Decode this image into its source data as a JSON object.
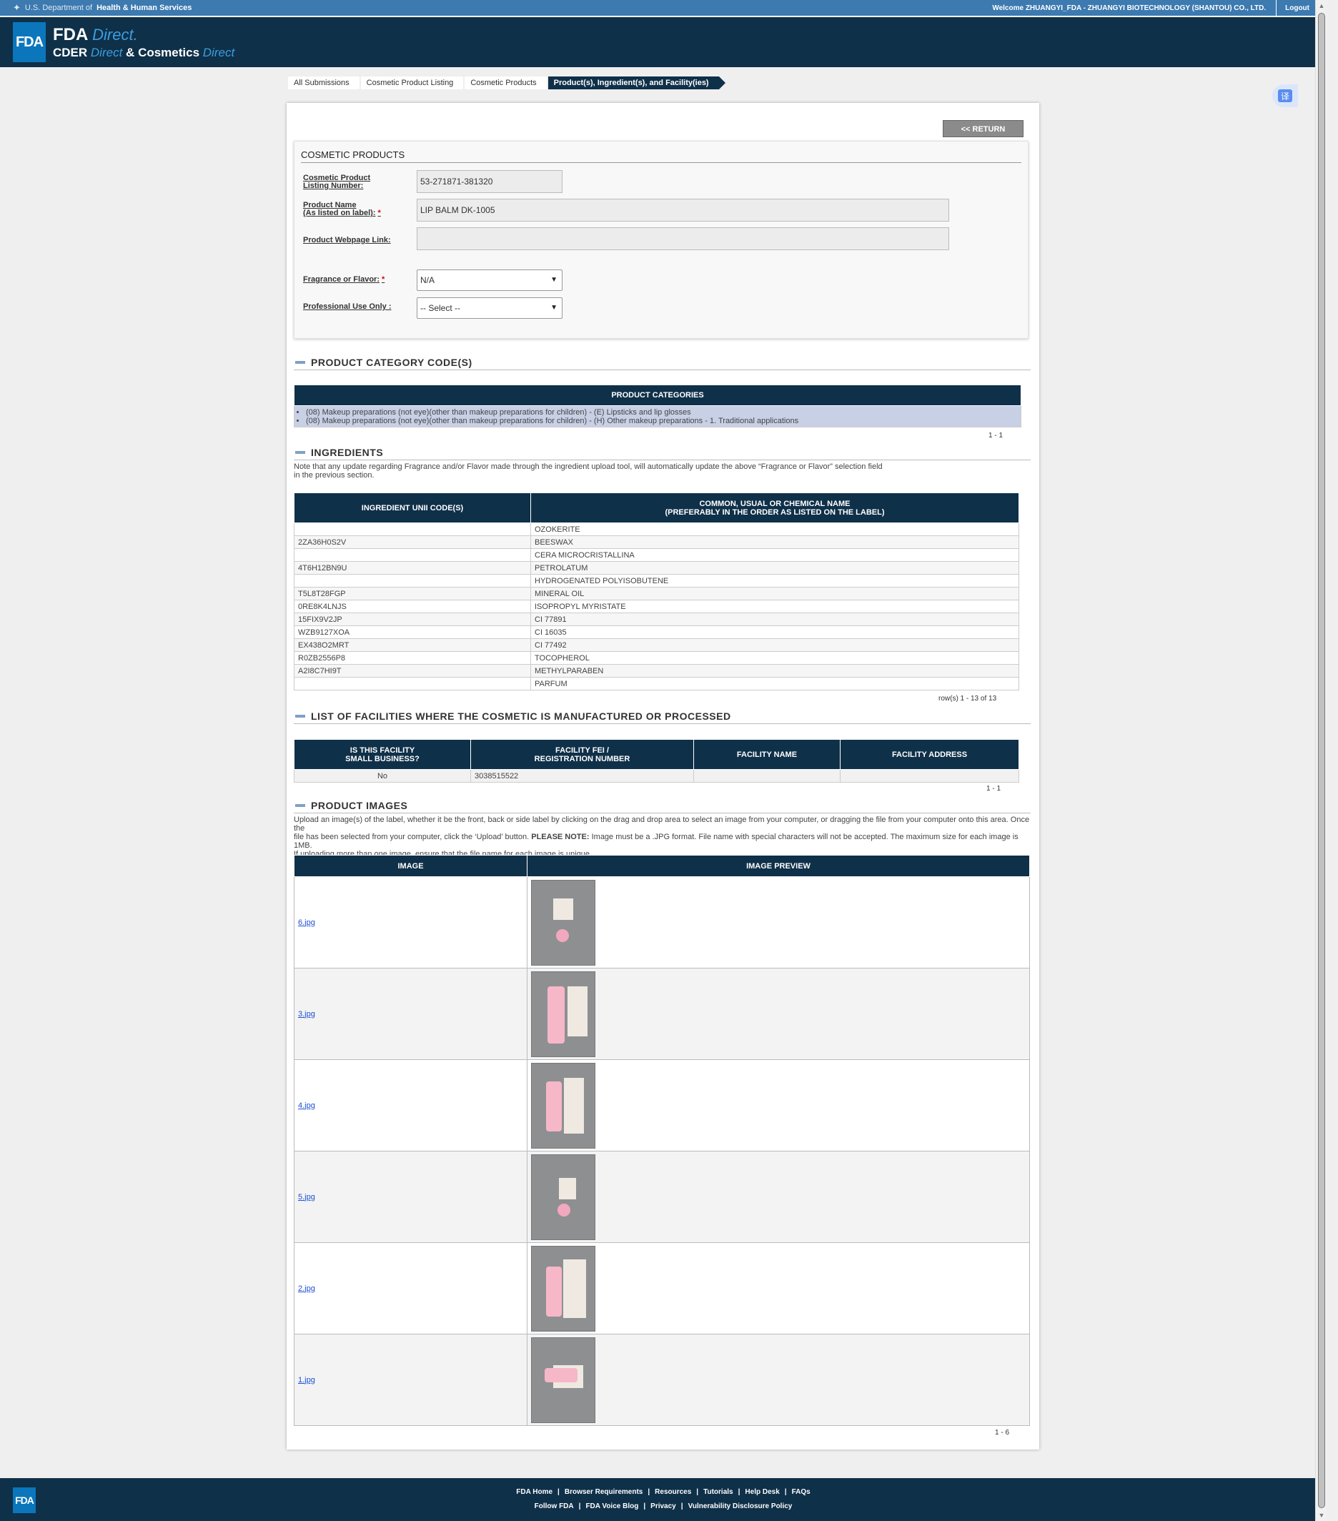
{
  "topbar": {
    "dept_prefix": "U.S. Department of",
    "dept_name": "Health & Human Services",
    "welcome": "Welcome ZHUANGYI_FDA - ZHUANGYI BIOTECHNOLOGY (SHANTOU) CO., LTD.",
    "logout": "Logout"
  },
  "header": {
    "logo": "FDA",
    "fda": "FDA",
    "direct": "Direct",
    "cder": "CDER",
    "direct2": "Direct",
    "amp": "&",
    "cosmetics": "Cosmetics",
    "direct3": "Direct"
  },
  "breadcrumb": [
    "All Submissions",
    "Cosmetic Product Listing",
    "Cosmetic Products",
    "Product(s), Ingredient(s), and Facility(ies)"
  ],
  "return_label": "<< RETURN",
  "cosmetic_products": {
    "title": "COSMETIC PRODUCTS",
    "listing_label_1": "Cosmetic Product",
    "listing_label_2": "Listing Number:",
    "listing_value": "53-271871-381320",
    "name_label_1": "Product Name",
    "name_label_2": "(As listed on label):",
    "name_value": "LIP BALM DK-1005",
    "webpage_label": "Product Webpage Link:",
    "webpage_value": "",
    "fragrance_label": "Fragrance or Flavor:",
    "fragrance_value": "N/A",
    "professional_label": "Professional Use Only :",
    "professional_value": "-- Select --",
    "required": "*"
  },
  "category_section": {
    "title": "PRODUCT CATEGORY CODE(S)",
    "column": "PRODUCT CATEGORIES",
    "items": [
      "(08) Makeup preparations (not eye)(other than makeup preparations for children) - (E) Lipsticks and lip glosses",
      "(08) Makeup preparations (not eye)(other than makeup preparations for children) - (H) Other makeup preparations - 1. Traditional applications"
    ],
    "count": "1 - 1"
  },
  "ingredients": {
    "title": "INGREDIENTS",
    "note_1": "Note that any update regarding Fragrance and/or Flavor made through the ingredient upload tool, will automatically update the above “Fragrance or Flavor” selection field",
    "note_2": "in the previous section.",
    "col_unii": "INGREDIENT UNII CODE(S)",
    "col_name_1": "COMMON, USUAL OR CHEMICAL NAME",
    "col_name_2": "(PREFERABLY IN THE ORDER AS LISTED ON THE LABEL)",
    "rows": [
      [
        "",
        "OZOKERITE"
      ],
      [
        "2ZA36H0S2V",
        "BEESWAX"
      ],
      [
        "",
        "CERA MICROCRISTALLINA"
      ],
      [
        "4T6H12BN9U",
        "PETROLATUM"
      ],
      [
        "",
        "HYDROGENATED POLYISOBUTENE"
      ],
      [
        "T5L8T28FGP",
        "MINERAL OIL"
      ],
      [
        "0RE8K4LNJS",
        "ISOPROPYL MYRISTATE"
      ],
      [
        "15FIX9V2JP",
        "CI 77891"
      ],
      [
        "WZB9127XOA",
        "CI 16035"
      ],
      [
        "EX438O2MRT",
        "CI 77492"
      ],
      [
        "R0ZB2556P8",
        "TOCOPHEROL"
      ],
      [
        "A2I8C7HI9T",
        "METHYLPARABEN"
      ],
      [
        "",
        "PARFUM"
      ]
    ],
    "count": "row(s) 1 - 13 of 13"
  },
  "facilities": {
    "title": "LIST OF FACILITIES WHERE THE COSMETIC IS MANUFACTURED OR PROCESSED",
    "col_small_1": "IS THIS FACILITY",
    "col_small_2": "SMALL BUSINESS?",
    "col_fei_1": "FACILITY FEI /",
    "col_fei_2": "REGISTRATION NUMBER",
    "col_name": "FACILITY NAME",
    "col_address": "FACILITY ADDRESS",
    "rows": [
      [
        "No",
        "3038515522",
        "",
        ""
      ]
    ],
    "count": "1 - 1"
  },
  "images": {
    "title": "PRODUCT IMAGES",
    "note_1": "Upload an image(s) of the label, whether it be the front, back or side label by clicking on the drag and drop area to select an image from your computer, or dragging the file from your computer onto this area. Once the",
    "note_2a": "file has been selected from your computer, click the ‘Upload’ button.",
    "note_2b": "PLEASE NOTE:",
    "note_2c": "Image must be a .JPG format. File name with special characters will not be accepted. The maximum size for each image is 1MB.",
    "note_3": "If uploading more than one image, ensure that the file name for each image is unique.",
    "col_image": "IMAGE",
    "col_preview": "IMAGE PREVIEW",
    "files": [
      "6.jpg",
      "3.jpg",
      "4.jpg",
      "5.jpg",
      "2.jpg",
      "1.jpg"
    ],
    "count": "1 - 6"
  },
  "footer": {
    "logo": "FDA",
    "row1": [
      "FDA Home",
      "Browser Requirements",
      "Resources",
      "Tutorials",
      "Help Desk",
      "FAQs"
    ],
    "row2": [
      "Follow FDA",
      "FDA Voice Blog",
      "Privacy",
      "Vulnerability Disclosure Policy"
    ],
    "sep": "|"
  }
}
